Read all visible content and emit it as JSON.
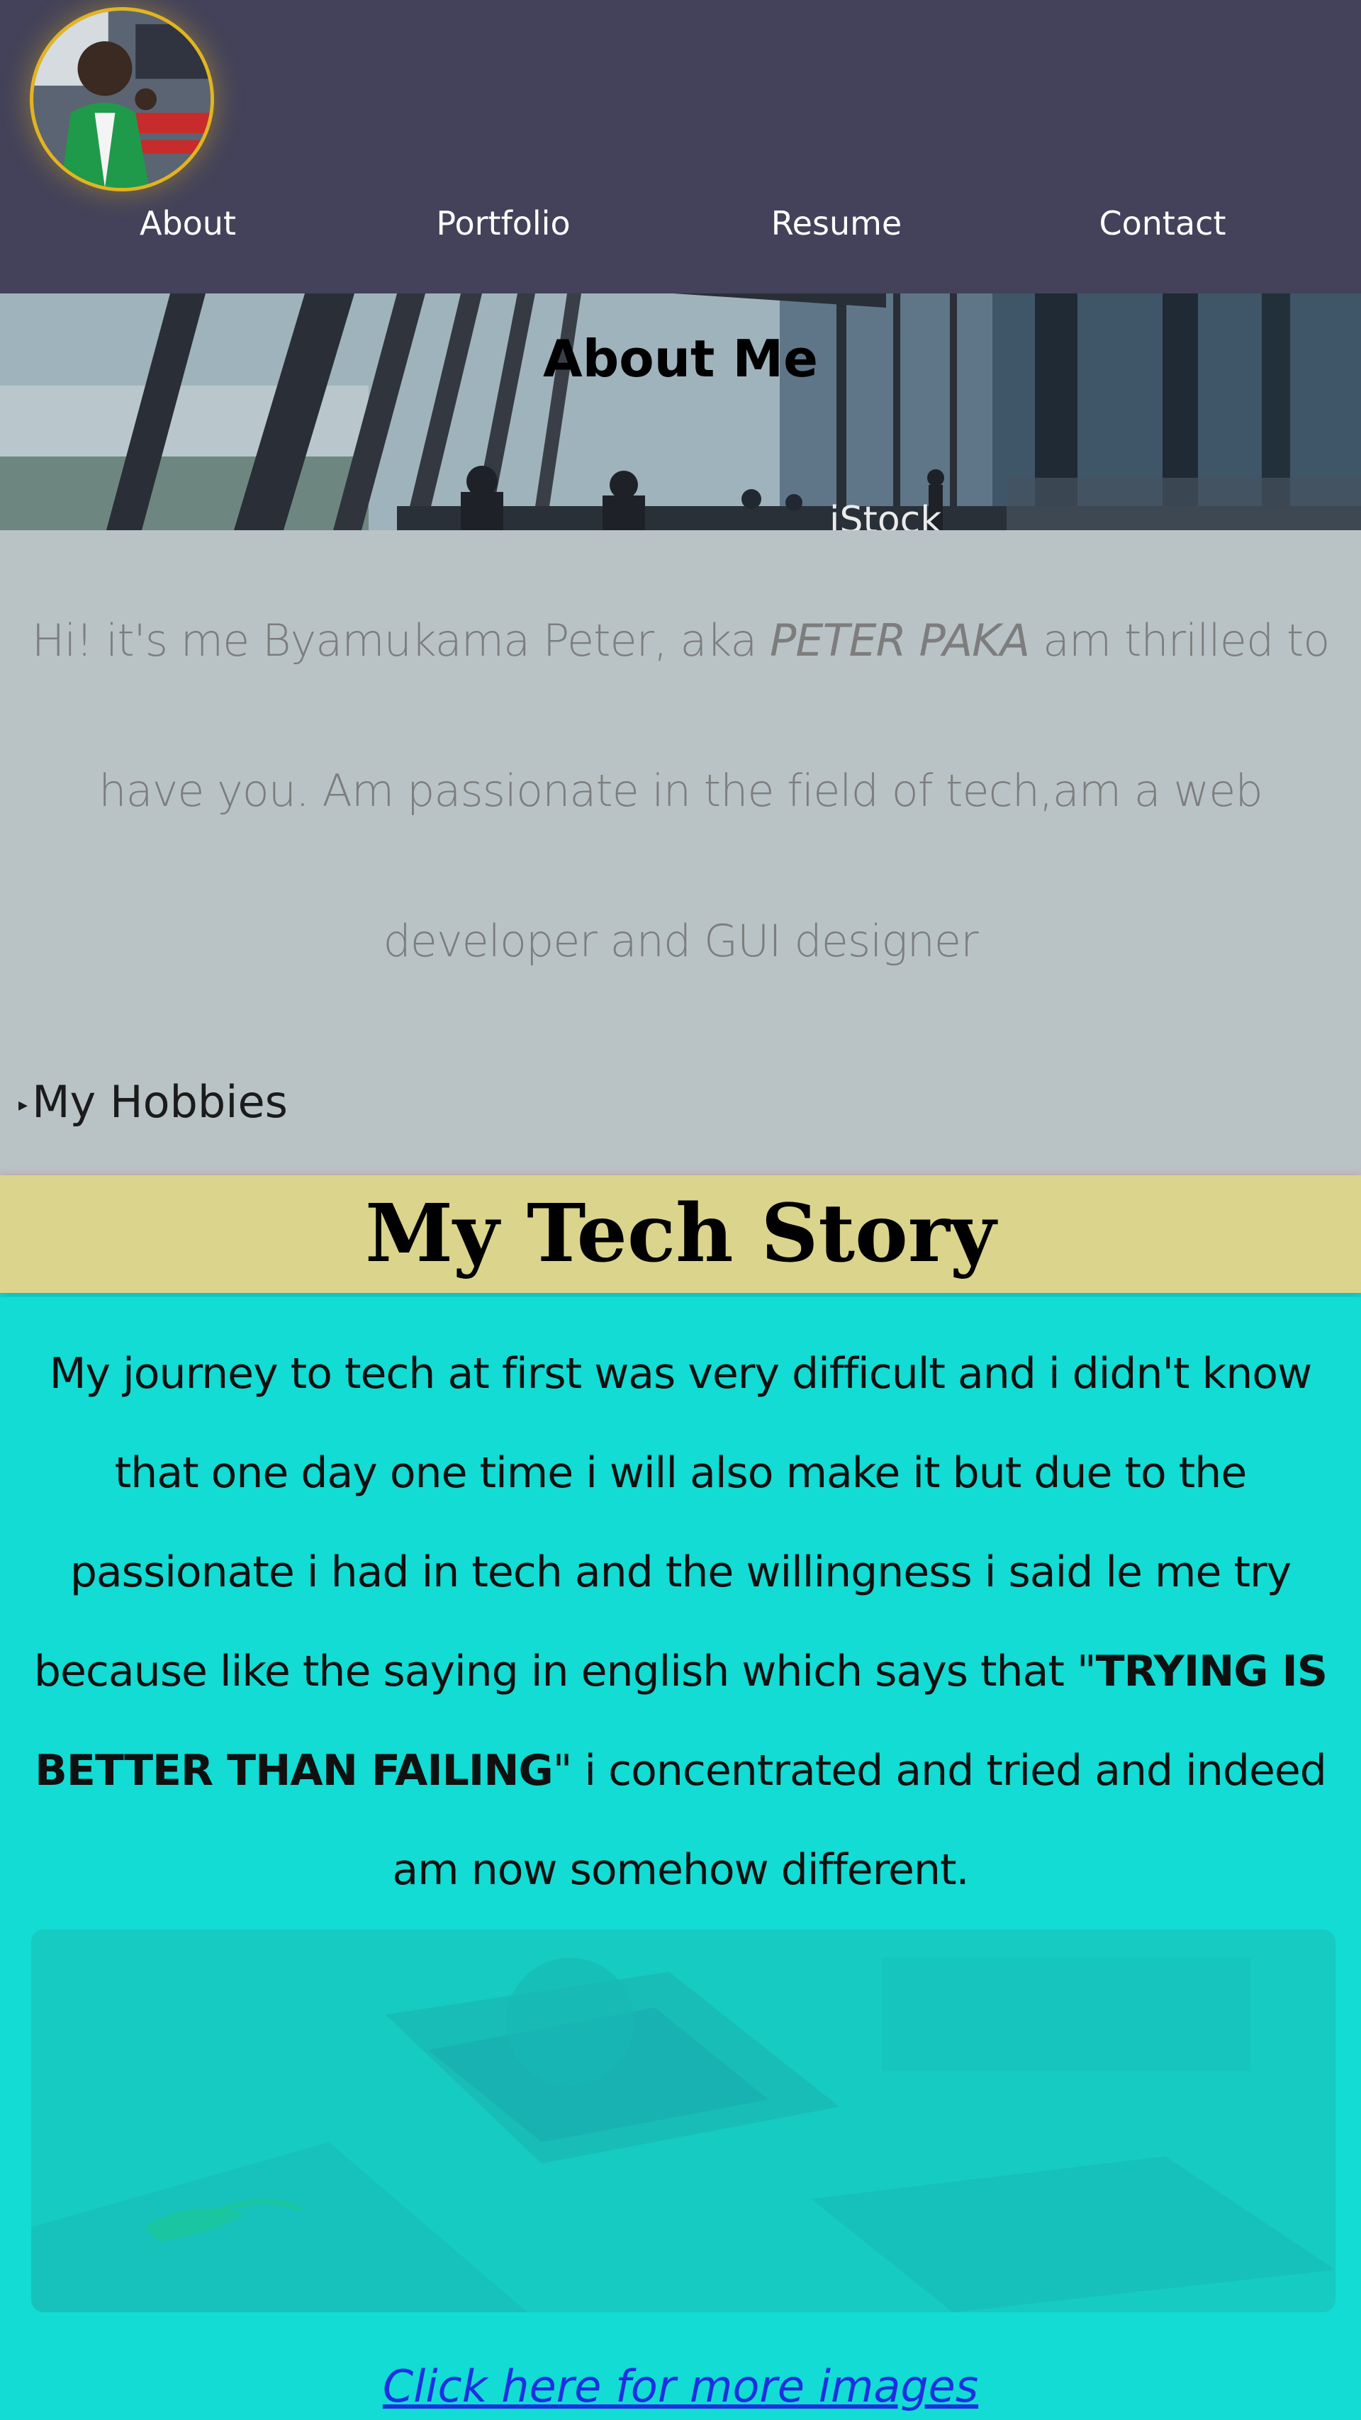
{
  "header": {
    "nav": [
      {
        "label": "About"
      },
      {
        "label": "Portfolio"
      },
      {
        "label": "Resume"
      },
      {
        "label": "Contact"
      }
    ]
  },
  "banner": {
    "title": "About Me",
    "watermark": "iStock"
  },
  "about": {
    "text_before": "Hi! it's me Byamukama Peter, aka ",
    "nickname": "PETER PAKA",
    "text_after": " am thrilled to have you. Am passionate in the field of tech,am a web developer and GUI designer",
    "hobbies_label": "My Hobbies"
  },
  "story": {
    "heading": "My Tech Story",
    "text_before": "My journey to tech at first was very difficult and i didn't know that one day one time i will also make it but due to the passionate i had in tech and the willingness i said le me try because like the saying in english which says that \"",
    "quote": "TRYING IS BETTER THAN FAILING",
    "text_after": "\" i concentrated and tried and indeed am now somehow different.",
    "link_label": "Click here for more images"
  },
  "colors": {
    "header_bg": "#43425a",
    "about_bg": "#b9c3c6",
    "story_heading_bg": "#dbd48c",
    "story_bg": "#12dcd4",
    "avatar_border": "#e2b41f",
    "link": "#1e2fe0"
  }
}
